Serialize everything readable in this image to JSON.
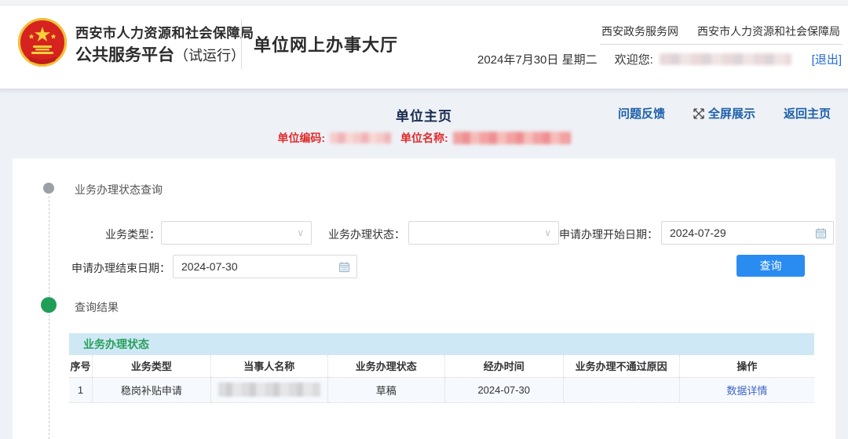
{
  "header": {
    "org_name": "西安市人力资源和社会保障局",
    "platform_name": "公共服务平台",
    "platform_suffix": "（试运行）",
    "hall_title": "单位网上办事大厅",
    "link_gov": "西安政务服务网",
    "link_hr": "西安市人力资源和社会保障局",
    "date_text": "2024年7月30日 星期二",
    "welcome_label": "欢迎您:",
    "logout_label": "[退出]"
  },
  "page_bar": {
    "title": "单位主页",
    "feedback_link": "问题反馈",
    "fullscreen_link": "全屏展示",
    "home_link": "返回主页",
    "unit_code_label": "单位编码:",
    "unit_name_label": "单位名称:"
  },
  "query": {
    "section_title": "业务办理状态查询",
    "business_type_label": "业务类型：",
    "status_label": "业务办理状态：",
    "start_date_label": "申请办理开始日期：",
    "start_date_value": "2024-07-29",
    "end_date_label": "申请办理结束日期：",
    "end_date_value": "2024-07-30",
    "query_button_label": "查询"
  },
  "results": {
    "section_title": "查询结果",
    "table_caption": "业务办理状态",
    "columns": [
      "序号",
      "业务类型",
      "当事人名称",
      "业务办理状态",
      "经办时间",
      "业务办理不通过原因",
      "操作"
    ],
    "rows": [
      {
        "seq": "1",
        "type": "稳岗补贴申请",
        "party": "",
        "status": "草稿",
        "time": "2024-07-30",
        "reason": "",
        "action": "数据详情"
      }
    ]
  },
  "icons": {
    "select_chevron": "∨"
  },
  "colors": {
    "accent_blue": "#2a8cf0",
    "link_blue": "#1d5fa9",
    "logout_blue": "#2468d4",
    "red_text": "#e02b2b",
    "green_text": "#2aa05c",
    "table_band_bg": "#cfe8f5",
    "page_bg": "#eef1f6"
  }
}
